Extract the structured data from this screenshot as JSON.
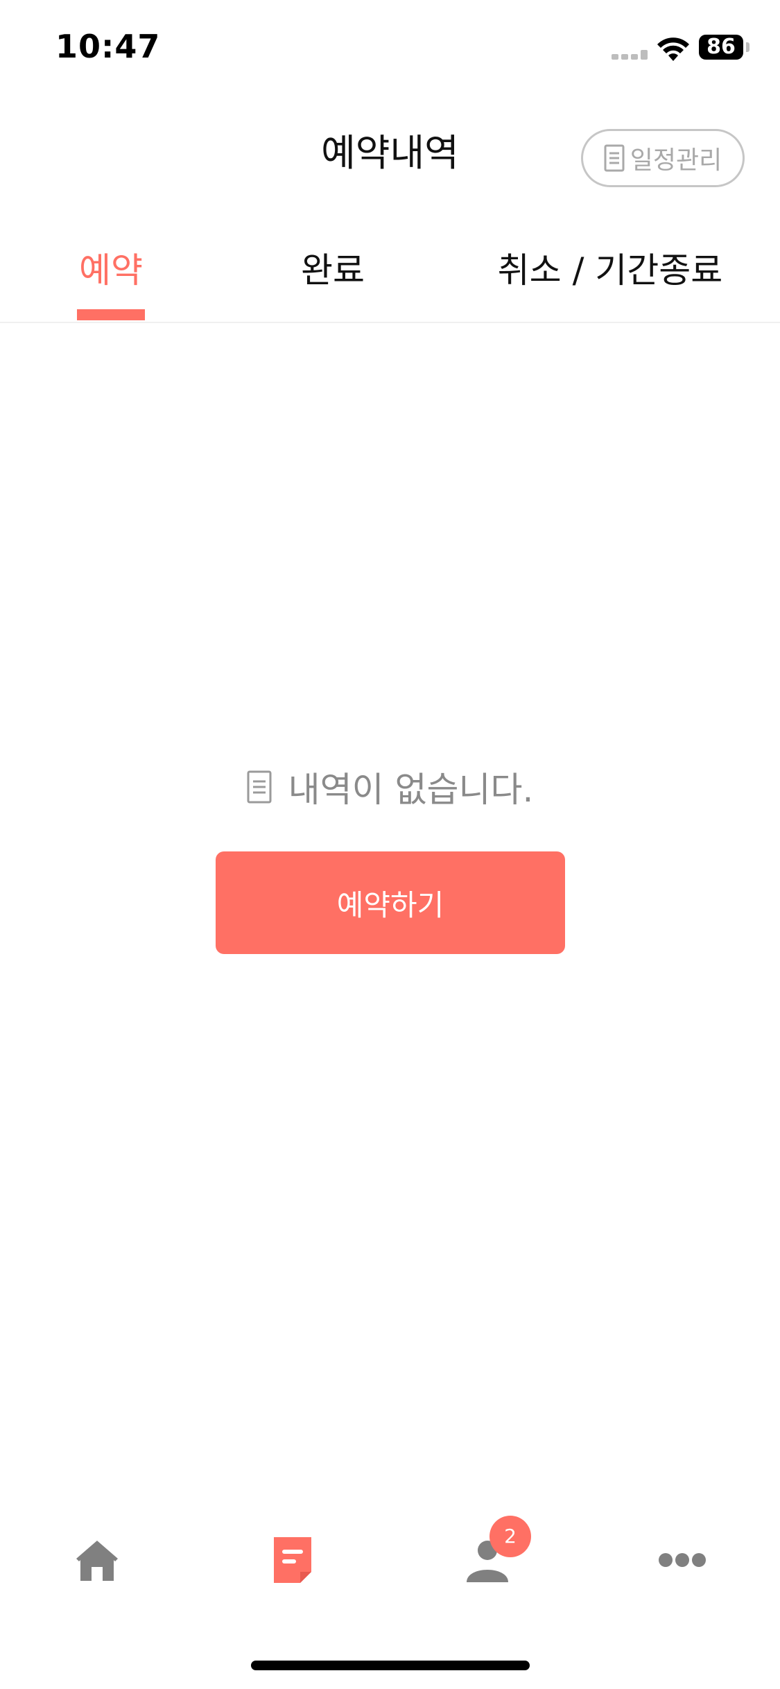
{
  "status_bar": {
    "time": "10:47",
    "battery_level": "86",
    "icons": [
      "cell-signal-icon",
      "wifi-icon",
      "battery-icon"
    ]
  },
  "header": {
    "title": "예약내역",
    "schedule_button_label": "일정관리",
    "schedule_button_icon": "document-icon"
  },
  "tabs": [
    {
      "label": "예약",
      "active": true
    },
    {
      "label": "완료",
      "active": false
    },
    {
      "label": "취소 / 기간종료",
      "active": false
    }
  ],
  "empty_state": {
    "icon": "document-icon",
    "message": "내역이 없습니다.",
    "button_label": "예약하기"
  },
  "bottom_nav": {
    "items": [
      {
        "icon": "home-icon",
        "active": false
      },
      {
        "icon": "document-icon",
        "active": true
      },
      {
        "icon": "person-icon",
        "active": false,
        "badge": "2"
      },
      {
        "icon": "more-icon",
        "active": false
      }
    ]
  },
  "colors": {
    "accent": "#ff7064",
    "inactive_icon": "#808080",
    "muted_text": "#8a8a8a"
  }
}
